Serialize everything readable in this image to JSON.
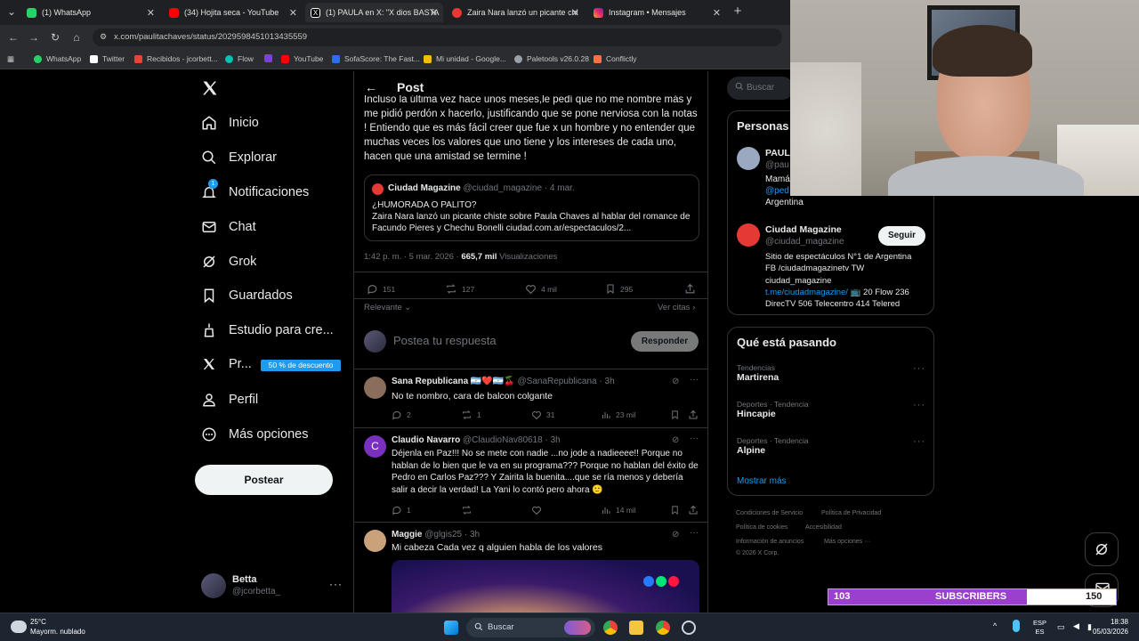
{
  "browser": {
    "tabs": [
      {
        "title": "(1) WhatsApp",
        "color": "#25d366"
      },
      {
        "title": "(34) Hojita seca - YouTube",
        "color": "#ff0000"
      },
      {
        "title": "(1) PAULA en X: \"X dios BASTA",
        "color": "#ffffff"
      },
      {
        "title": "Zaira Nara lanzó un picante chi",
        "color": "#e53935"
      },
      {
        "title": "Instagram • Mensajes",
        "color": "#e1306c"
      }
    ],
    "url": "x.com/paulitachaves/status/2029598451013435559",
    "bookmarks": [
      {
        "label": "WhatsApp",
        "color": "#25d366"
      },
      {
        "label": "Twitter",
        "color": "#ffffff"
      },
      {
        "label": "Recibidos - jcorbett...",
        "color": "#ea4335"
      },
      {
        "label": "Flow",
        "color": "#00c2b2"
      },
      {
        "label": "",
        "color": "#7b3fe4"
      },
      {
        "label": "YouTube",
        "color": "#ff0000"
      },
      {
        "label": "SofaScore: The Fast...",
        "color": "#2c6cf6"
      },
      {
        "label": "Mi unidad - Google...",
        "color": "#fbbc04"
      },
      {
        "label": "Paletools v26.0.28",
        "color": "#9aa0a6"
      },
      {
        "label": "Conflictly",
        "color": "#ff7043"
      }
    ]
  },
  "sidebar": {
    "items": [
      {
        "label": "Inicio",
        "icon": "home-icon"
      },
      {
        "label": "Explorar",
        "icon": "search-icon"
      },
      {
        "label": "Notificaciones",
        "icon": "bell-icon"
      },
      {
        "label": "Chat",
        "icon": "mail-icon"
      },
      {
        "label": "Grok",
        "icon": "grok-icon"
      },
      {
        "label": "Guardados",
        "icon": "bookmark-icon"
      },
      {
        "label": "Estudio para cre...",
        "icon": "creator-icon"
      },
      {
        "label": "Pr...",
        "icon": "x-logo-icon"
      },
      {
        "label": "Perfil",
        "icon": "person-icon"
      },
      {
        "label": "Más opciones",
        "icon": "more-circle-icon"
      }
    ],
    "notif_badge": "1",
    "promo_badge": "50 % de descuento",
    "post_button": "Postear",
    "account": {
      "name": "Betta",
      "handle": "@jcorbetta_"
    }
  },
  "post": {
    "header_title": "Post",
    "body_text": "Incluso la última vez hace unos meses,le pedí que no me nombre más y me pidió perdón x hacerlo, justificando que se pone nerviosa con la notas ! Entiendo que es más fácil creer que fue x un hombre y no entender que muchas veces los valores que uno tiene  y los intereses de cada uno, hacen que una amistad se termine !",
    "quote": {
      "name": "Ciudad Magazine",
      "handle": "@ciudad_magazine",
      "date": "· 4 mar.",
      "line1": "¿HUMORADA O PALITO?",
      "line2": "Zaira Nara lanzó un picante chiste sobre Paula Chaves al hablar del romance de Facundo Pieres y Chechu Bonelli ciudad.com.ar/espectaculos/2..."
    },
    "meta_time": "1:42 p. m. · 5 mar. 2026 ·",
    "meta_views": "665,7 mil",
    "meta_views_label": "Visualizaciones",
    "stats": {
      "replies": "151",
      "reposts": "127",
      "likes": "4 mil",
      "bookmarks": "295"
    },
    "sort_label": "Relevante",
    "quotes_link": "Ver citas",
    "reply_placeholder": "Postea tu respuesta",
    "reply_button": "Responder"
  },
  "replies": [
    {
      "name": "Sana Republicana 🇦🇷❤️🇦🇷🍒",
      "handle": "@SanaRepublicana · 3h",
      "text": "No te nombro, cara de balcon colgante",
      "replies": "2",
      "reposts": "1",
      "likes": "31",
      "views": "23 mil",
      "avatar_letter": "",
      "avatar_color": "#8a6d5a"
    },
    {
      "name": "Claudio Navarro",
      "handle": "@ClaudioNav80618 · 3h",
      "text": "Déjenla en Paz!!! No se mete con nadie ...no jode a nadieeee!! Porque no hablan de lo bien que le va en su programa??? Porque no hablan del éxito de Pedro en Carlos Paz??? Y Zairita la buenita....que se ría menos y debería salir a decir la verdad! La Yani lo contó pero ahora 🙂",
      "replies": "1",
      "reposts": "",
      "likes": "",
      "views": "14 mil",
      "avatar_letter": "C",
      "avatar_color": "#7b2fbe"
    },
    {
      "name": "Maggie",
      "handle": "@glgis25 · 3h",
      "text": "Mi cabeza Cada vez q alguien habla de los valores",
      "avatar_letter": "",
      "avatar_color": "#c9a27c"
    }
  ],
  "right": {
    "search_placeholder": "Buscar",
    "people_title": "Personas",
    "person1": {
      "name": "PAUL",
      "handle": "@pau",
      "bio1": "Mamá",
      "bio2": "@ped",
      "bio3": "Argentina"
    },
    "person2": {
      "name": "Ciudad Magazine",
      "handle": "@ciudad_magazine",
      "follow": "Seguir",
      "bio1": "Sitio de espectáculos N°1 de Argentina",
      "bio2": "FB /ciudadmagazinetv TW",
      "bio3": "ciudad_magazine",
      "bio_link": "t.me/ciudadmagazine/",
      "bio4": "📺 20 Flow 236",
      "bio5": "DirecTV 506 Telecentro 414 Telered"
    },
    "trends_title": "Qué está pasando",
    "trends": [
      {
        "category": "Tendencias",
        "name": "Martirena"
      },
      {
        "category": "Deportes · Tendencia",
        "name": "Hincapie"
      },
      {
        "category": "Deportes · Tendencia",
        "name": "Alpine"
      }
    ],
    "show_more": "Mostrar más",
    "footer": {
      "l1a": "Condiciones de Servicio",
      "l1b": "Política de Privacidad",
      "l2a": "Política de cookies",
      "l2b": "Accesibilidad",
      "l3a": "Información de anuncios",
      "l3b": "Más opciones ···",
      "l4": "© 2026 X Corp."
    }
  },
  "overlay": {
    "subs_count": "103",
    "subs_label": "SUBSCRIBERS",
    "subs_goal": "150",
    "subs_progress": 0.69
  },
  "taskbar": {
    "temp": "25°C",
    "weather": "Mayorm. nublado",
    "search": "Buscar",
    "lang1": "ESP",
    "lang2": "ES",
    "time": "18:38",
    "date": "05/03/2026"
  }
}
